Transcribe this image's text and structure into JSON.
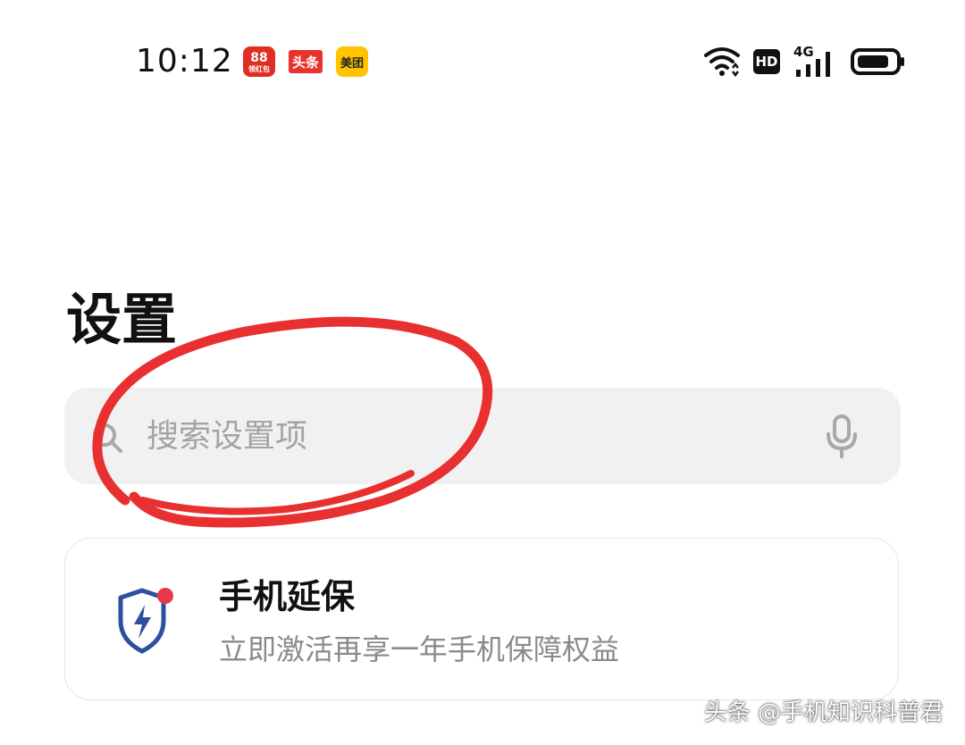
{
  "status_bar": {
    "time": "10:12",
    "apps": [
      {
        "name": "pinduoduo-app-icon",
        "label": "领红包",
        "color": "#e02e24"
      },
      {
        "name": "toutiao-app-icon",
        "label": "头条",
        "color": "#e8322e"
      },
      {
        "name": "meituan-app-icon",
        "label": "美团",
        "color": "#ffc300"
      }
    ],
    "hd_label": "HD",
    "network_label": "4G",
    "icons": [
      "wifi-icon",
      "hd-icon",
      "signal-4g-icon",
      "battery-icon"
    ]
  },
  "page": {
    "title": "设置"
  },
  "search": {
    "placeholder": "搜索设置项",
    "icons": [
      "search-icon",
      "microphone-icon"
    ]
  },
  "card": {
    "title": "手机延保",
    "subtitle": "立即激活再享一年手机保障权益",
    "icon": "shield-lightning-icon",
    "badge_color": "#e8394a",
    "icon_color": "#2f4f9e"
  },
  "annotation": {
    "color": "#e83030"
  },
  "watermark": {
    "text": "头条 @手机知识科普君"
  }
}
